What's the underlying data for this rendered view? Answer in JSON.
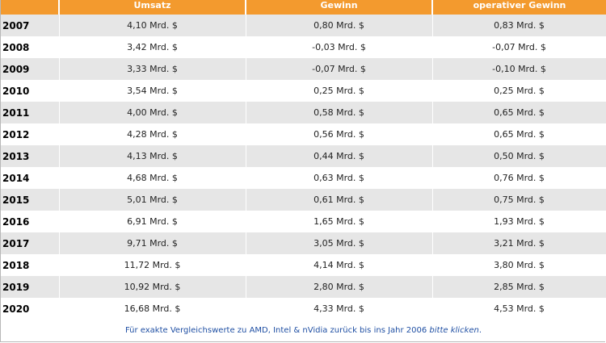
{
  "table": {
    "headers": {
      "year": "",
      "umsatz": "Umsatz",
      "gewinn": "Gewinn",
      "operativer_gewinn": "operativer Gewinn"
    },
    "rows": [
      {
        "year": "2007",
        "umsatz": "4,10 Mrd. $",
        "gewinn": "0,80 Mrd. $",
        "operativer_gewinn": "0,83 Mrd. $"
      },
      {
        "year": "2008",
        "umsatz": "3,42 Mrd. $",
        "gewinn": "-0,03 Mrd. $",
        "operativer_gewinn": "-0,07 Mrd. $"
      },
      {
        "year": "2009",
        "umsatz": "3,33 Mrd. $",
        "gewinn": "-0,07 Mrd. $",
        "operativer_gewinn": "-0,10 Mrd. $"
      },
      {
        "year": "2010",
        "umsatz": "3,54 Mrd. $",
        "gewinn": "0,25 Mrd. $",
        "operativer_gewinn": "0,25 Mrd. $"
      },
      {
        "year": "2011",
        "umsatz": "4,00 Mrd. $",
        "gewinn": "0,58 Mrd. $",
        "operativer_gewinn": "0,65 Mrd. $"
      },
      {
        "year": "2012",
        "umsatz": "4,28 Mrd. $",
        "gewinn": "0,56 Mrd. $",
        "operativer_gewinn": "0,65 Mrd. $"
      },
      {
        "year": "2013",
        "umsatz": "4,13 Mrd. $",
        "gewinn": "0,44 Mrd. $",
        "operativer_gewinn": "0,50 Mrd. $"
      },
      {
        "year": "2014",
        "umsatz": "4,68 Mrd. $",
        "gewinn": "0,63 Mrd. $",
        "operativer_gewinn": "0,76 Mrd. $"
      },
      {
        "year": "2015",
        "umsatz": "5,01 Mrd. $",
        "gewinn": "0,61 Mrd. $",
        "operativer_gewinn": "0,75 Mrd. $"
      },
      {
        "year": "2016",
        "umsatz": "6,91 Mrd. $",
        "gewinn": "1,65 Mrd. $",
        "operativer_gewinn": "1,93 Mrd. $"
      },
      {
        "year": "2017",
        "umsatz": "9,71 Mrd. $",
        "gewinn": "3,05 Mrd. $",
        "operativer_gewinn": "3,21 Mrd. $"
      },
      {
        "year": "2018",
        "umsatz": "11,72 Mrd. $",
        "gewinn": "4,14 Mrd. $",
        "operativer_gewinn": "3,80 Mrd. $"
      },
      {
        "year": "2019",
        "umsatz": "10,92 Mrd. $",
        "gewinn": "2,80 Mrd. $",
        "operativer_gewinn": "2,85 Mrd. $"
      },
      {
        "year": "2020",
        "umsatz": "16,68 Mrd. $",
        "gewinn": "4,33 Mrd. $",
        "operativer_gewinn": "4,53 Mrd. $"
      }
    ]
  },
  "footer": {
    "text": "Für exakte Vergleichswerte zu AMD, Intel & nVidia zurück bis ins Jahr 2006 ",
    "link_label": "bitte klicken",
    "suffix": "."
  },
  "colors": {
    "header_bg": "#f39a2e",
    "row_alt_bg": "#e6e6e6",
    "footer_text": "#1f4fa3"
  }
}
